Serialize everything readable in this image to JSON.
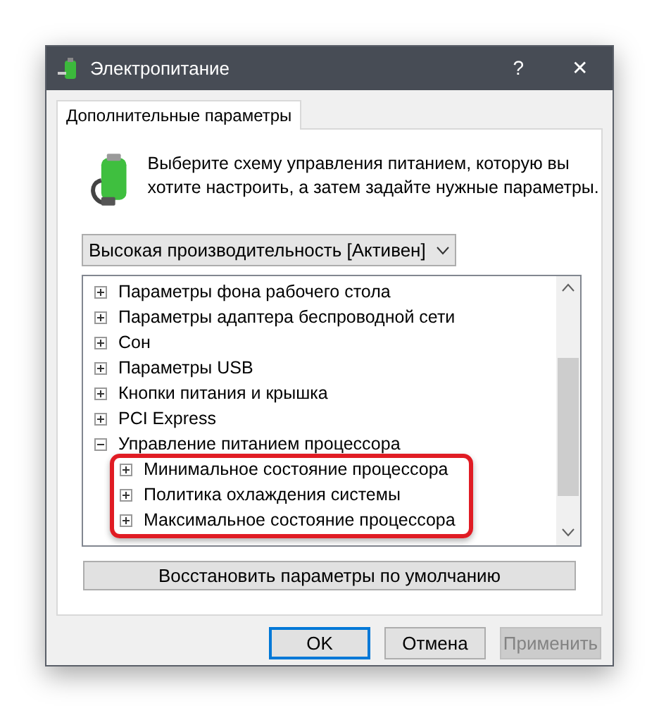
{
  "window": {
    "title": "Электропитание",
    "help": "?",
    "close": "✕"
  },
  "tabs": [
    {
      "label": "Дополнительные параметры",
      "selected": true
    }
  ],
  "intro": "Выберите схему управления питанием, которую вы хотите настроить, а затем задайте нужные параметры.",
  "plan_dropdown": {
    "value": "Высокая производительность [Активен]"
  },
  "tree": [
    {
      "label": "Параметры фона рабочего стола",
      "expanded": false
    },
    {
      "label": "Параметры адаптера беспроводной сети",
      "expanded": false
    },
    {
      "label": "Сон",
      "expanded": false
    },
    {
      "label": "Параметры USB",
      "expanded": false
    },
    {
      "label": "Кнопки питания и крышка",
      "expanded": false
    },
    {
      "label": "PCI Express",
      "expanded": false
    },
    {
      "label": "Управление питанием процессора",
      "expanded": true,
      "children": [
        {
          "label": "Минимальное состояние процессора",
          "expanded": false
        },
        {
          "label": "Политика охлаждения системы",
          "expanded": false
        },
        {
          "label": "Максимальное состояние процессора",
          "expanded": false
        }
      ]
    }
  ],
  "restore_button": "Восстановить параметры по умолчанию",
  "buttons": [
    {
      "label": "OK",
      "kind": "default"
    },
    {
      "label": "Отмена",
      "kind": "normal"
    },
    {
      "label": "Применить",
      "kind": "disabled"
    }
  ]
}
